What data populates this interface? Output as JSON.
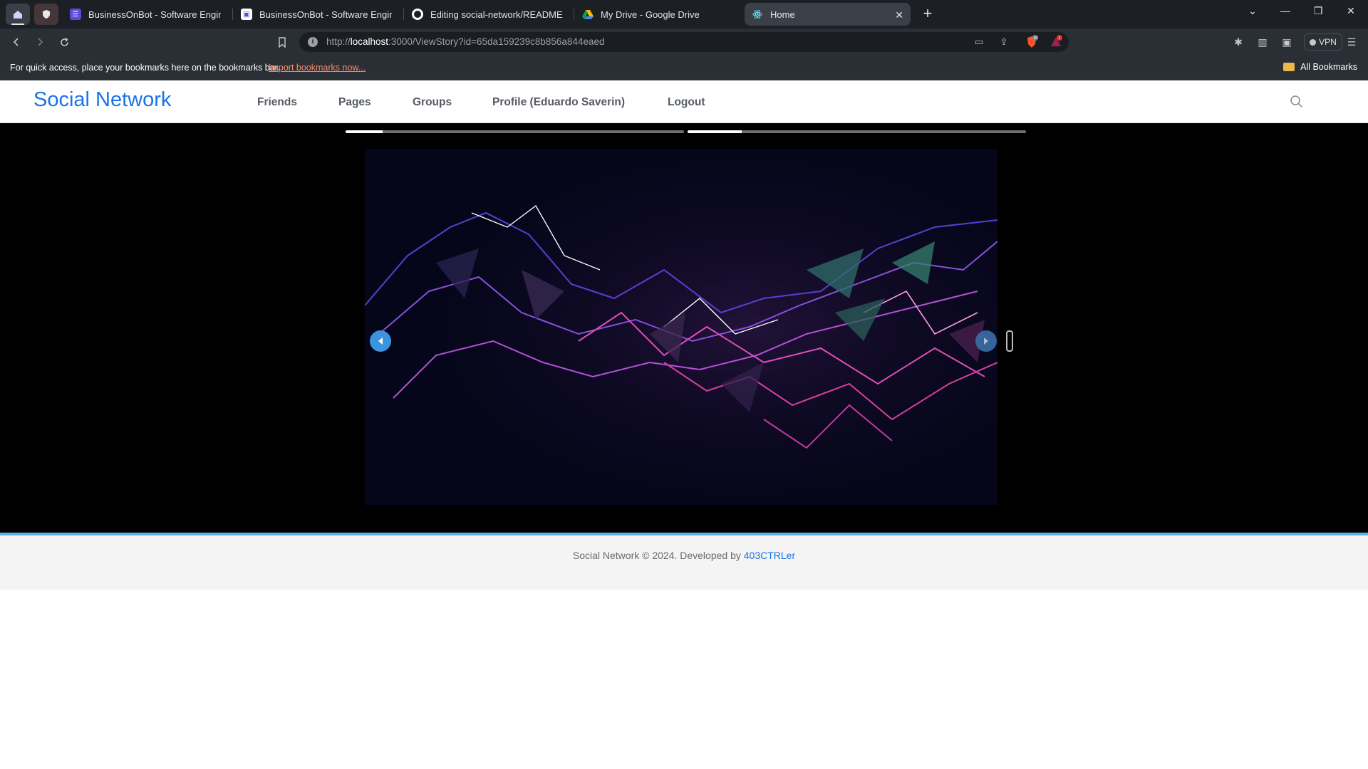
{
  "browser": {
    "tabs": [
      {
        "title": "BusinessOnBot - Software Engineerin",
        "icon": "businessonbot-icon"
      },
      {
        "title": "BusinessOnBot - Software Engineerin",
        "icon": "businessonbot-alt-icon"
      },
      {
        "title": "Editing social-network/README.md",
        "icon": "github-icon"
      },
      {
        "title": "My Drive - Google Drive",
        "icon": "google-drive-icon"
      },
      {
        "title": "Home",
        "icon": "react-icon",
        "active": true
      }
    ],
    "url": {
      "scheme": "http://",
      "host": "localhost",
      "rest": ":3000/ViewStory?id=65da159239c8b856a844eaed"
    },
    "vpn_label": "VPN",
    "shield_count": "10",
    "alert_count": "1",
    "bookmarks_bar": {
      "prompt": "For quick access, place your bookmarks here on the bookmarks bar.",
      "import_link": "Import bookmarks now...",
      "all_bookmarks": "All Bookmarks"
    }
  },
  "site": {
    "brand": "Social Network",
    "nav": [
      "Friends",
      "Pages",
      "Groups",
      "Profile (Eduardo Saverin)",
      "Logout"
    ]
  },
  "story": {
    "progress": [
      0.11,
      0.16
    ],
    "image_description_icon": "abstract-neon-mesh-image"
  },
  "footer": {
    "text": "Social Network © 2024. Developed by ",
    "developer": "403CTRLer"
  },
  "colors": {
    "brand": "#1a73e8",
    "footer_accent": "#59b3e6",
    "chrome_bg": "#1c1f24",
    "story_bg": "#000000"
  }
}
